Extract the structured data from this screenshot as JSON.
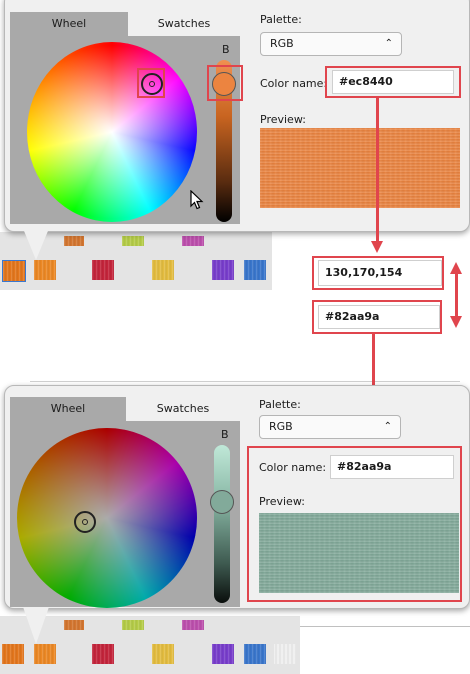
{
  "top_dialog": {
    "tabs": [
      {
        "label": "Wheel"
      },
      {
        "label": "Swatches"
      }
    ],
    "brightness_label": "B",
    "palette_label": "Palette:",
    "palette_value": "RGB",
    "color_name_label": "Color name:",
    "color_name_value": "#ec8440",
    "preview_label": "Preview:",
    "preview_color": "#ec8440"
  },
  "middle": {
    "rgb_field_value": "130,170,154",
    "hex_field_value": "#82aa9a"
  },
  "bottom_dialog": {
    "tabs": [
      {
        "label": "Wheel"
      },
      {
        "label": "Swatches"
      }
    ],
    "brightness_label": "B",
    "palette_label": "Palette:",
    "palette_value": "RGB",
    "color_name_label": "Color name:",
    "color_name_value": "#82aa9a",
    "preview_label": "Preview:",
    "preview_color": "#82aa9a"
  },
  "colors": {
    "highlight": "#e0454d",
    "panel_bg": "#f0f0f0",
    "wheel_bg": "#a9a9a9"
  },
  "swatches": [
    "#e8781c",
    "#f08a24",
    "#c8243c",
    "#e8c040",
    "#7a3ed0",
    "#3a78d0",
    "#ffffff"
  ],
  "icons": [
    "chevron-down-icon",
    "mouse-pointer-icon",
    "double-arrow-icon"
  ]
}
